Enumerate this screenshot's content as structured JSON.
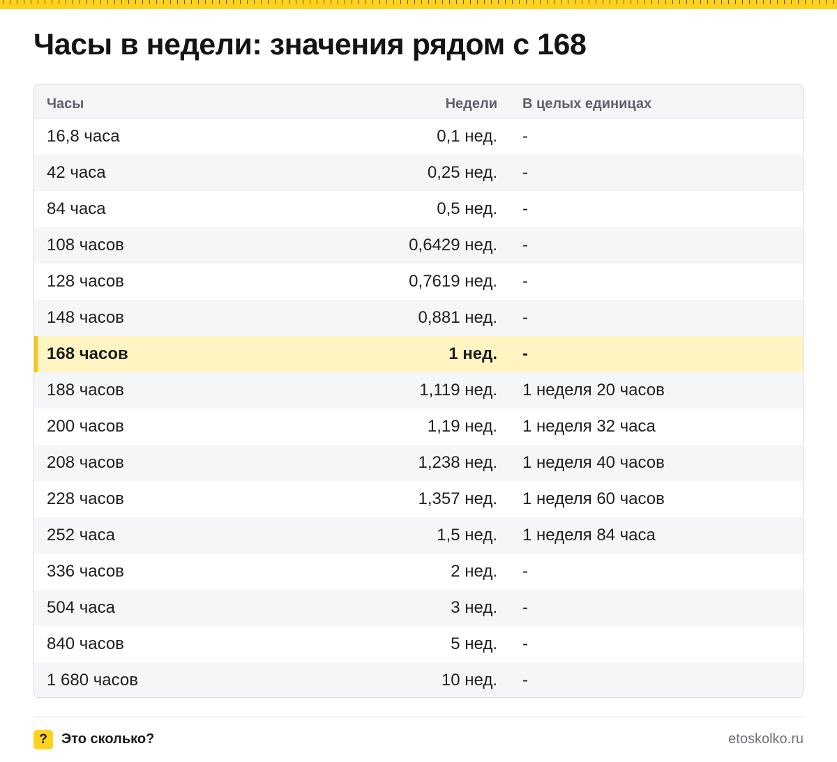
{
  "title": "Часы в недели: значения рядом с 168",
  "table": {
    "headers": {
      "hours": "Часы",
      "weeks": "Недели",
      "whole": "В целых единицах"
    },
    "rows": [
      {
        "hours": "16,8 часа",
        "weeks": "0,1 нед.",
        "whole": "-"
      },
      {
        "hours": "42 часа",
        "weeks": "0,25 нед.",
        "whole": "-"
      },
      {
        "hours": "84 часа",
        "weeks": "0,5 нед.",
        "whole": "-"
      },
      {
        "hours": "108 часов",
        "weeks": "0,6429 нед.",
        "whole": "-"
      },
      {
        "hours": "128 часов",
        "weeks": "0,7619 нед.",
        "whole": "-"
      },
      {
        "hours": "148 часов",
        "weeks": "0,881 нед.",
        "whole": "-"
      },
      {
        "hours": "168 часов",
        "weeks": "1 нед.",
        "whole": "-"
      },
      {
        "hours": "188 часов",
        "weeks": "1,119 нед.",
        "whole": "1 неделя 20 часов"
      },
      {
        "hours": "200 часов",
        "weeks": "1,19 нед.",
        "whole": "1 неделя 32 часа"
      },
      {
        "hours": "208 часов",
        "weeks": "1,238 нед.",
        "whole": "1 неделя 40 часов"
      },
      {
        "hours": "228 часов",
        "weeks": "1,357 нед.",
        "whole": "1 неделя 60 часов"
      },
      {
        "hours": "252 часа",
        "weeks": "1,5 нед.",
        "whole": "1 неделя 84 часа"
      },
      {
        "hours": "336 часов",
        "weeks": "2 нед.",
        "whole": "-"
      },
      {
        "hours": "504 часа",
        "weeks": "3 нед.",
        "whole": "-"
      },
      {
        "hours": "840 часов",
        "weeks": "5 нед.",
        "whole": "-"
      },
      {
        "hours": "1 680 часов",
        "weeks": "10 нед.",
        "whole": "-"
      }
    ],
    "highlighted_row": 6
  },
  "footer": {
    "logo_symbol": "?",
    "brand": "Это сколько?",
    "site": "etoskolko.ru"
  },
  "colors": {
    "accent": "#ffd21f",
    "highlight_row": "#fff4c2",
    "highlight_marker": "#f5c518",
    "alt_row": "#f5f6f8"
  }
}
